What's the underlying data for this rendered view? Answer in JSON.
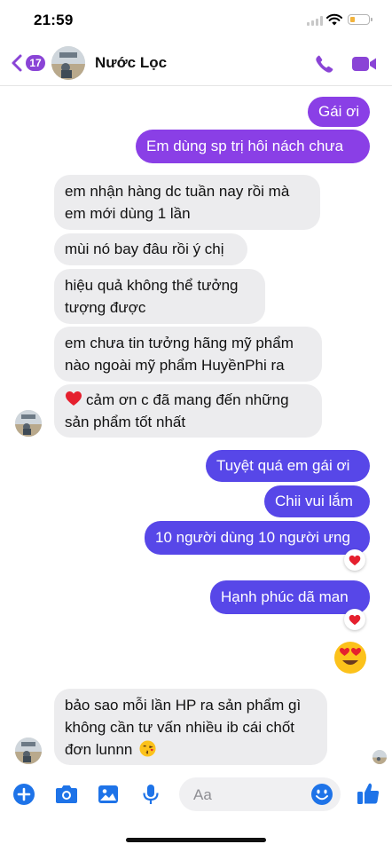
{
  "status_bar": {
    "time": "21:59"
  },
  "header": {
    "back_count": "17",
    "contact_name": "Nước Lọc"
  },
  "messages": [
    {
      "id": "m1",
      "side": "out",
      "text": "Gái ơi"
    },
    {
      "id": "m2",
      "side": "out",
      "text": "Em dùng sp trị hôi nách chưa"
    },
    {
      "id": "m3",
      "side": "in",
      "lines": [
        "em nhận hàng dc tuần nay rồi mà",
        "em mới dùng 1 lần"
      ]
    },
    {
      "id": "m4",
      "side": "in",
      "lines": [
        "mùi nó bay đâu rồi ý chị"
      ]
    },
    {
      "id": "m5",
      "side": "in",
      "lines": [
        "hiệu quả không thể tưởng",
        "tượng được"
      ]
    },
    {
      "id": "m6",
      "side": "in",
      "lines": [
        "em chưa tin tưởng hãng mỹ phẩm",
        "nào ngoài mỹ phẩm HuyềnPhi ra"
      ]
    },
    {
      "id": "m7",
      "side": "in",
      "lines": [
        "cảm ơn c đã mang đến những",
        "sản phẩm tốt nhất"
      ],
      "emoji": "heart"
    },
    {
      "id": "m8",
      "side": "out",
      "text": "Tuyệt quá em gái ơi"
    },
    {
      "id": "m9",
      "side": "out",
      "text": "Chii vui lắm"
    },
    {
      "id": "m10",
      "side": "out",
      "text": "10 người dùng 10 người ưng",
      "reaction": "heart"
    },
    {
      "id": "m11",
      "side": "out",
      "text": "Hạnh phúc dã man",
      "reaction": "heart"
    },
    {
      "id": "m12",
      "side": "out",
      "emoji": "heart-eyes-face"
    },
    {
      "id": "m13",
      "side": "in",
      "lines": [
        "bảo sao mỗi lần HP ra sản phẩm gì",
        "không cần tư vấn nhiều ib cái chốt",
        "đơn lunnn"
      ],
      "emoji": "kissing-face"
    }
  ],
  "composer": {
    "placeholder": "Aa"
  },
  "colors": {
    "accent": "#8a44d6",
    "outgoing_top": "#8a3fe6",
    "outgoing_bottom": "#5747e8",
    "incoming": "#ececee",
    "toolbar_icons": "#1e73e8"
  }
}
